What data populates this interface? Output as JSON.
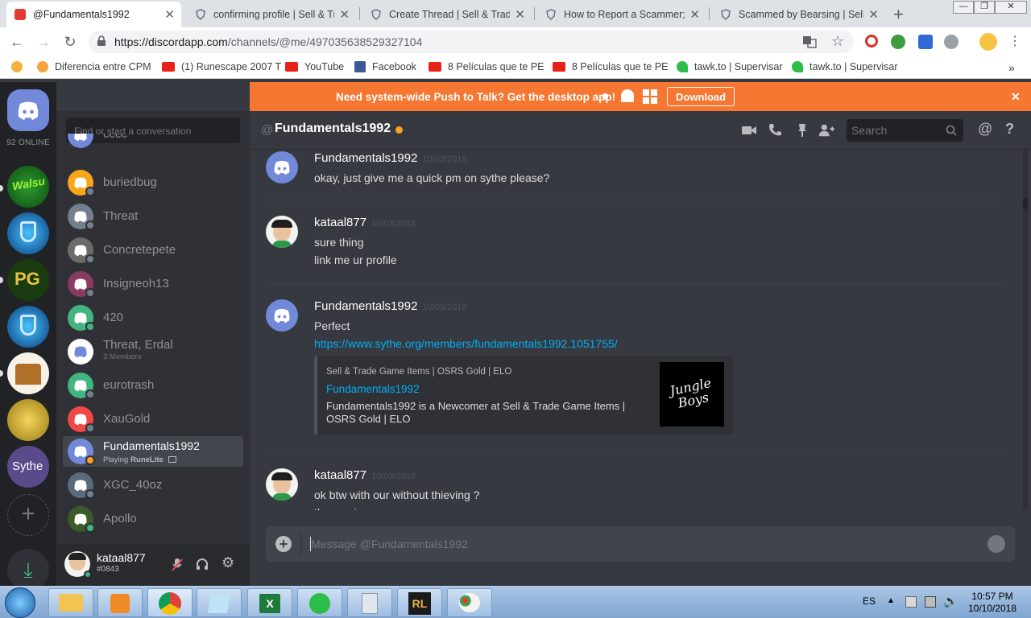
{
  "browser": {
    "tabs": [
      {
        "title": "@Fundamentals1992",
        "active": true,
        "icon": "discord-favicon"
      },
      {
        "title": "confirming profile | Sell & Tra",
        "active": false,
        "icon": "sythe-shield-favicon"
      },
      {
        "title": "Create Thread | Sell & Trade",
        "active": false,
        "icon": "sythe-shield-favicon"
      },
      {
        "title": "How to Report a Scammer; R",
        "active": false,
        "icon": "sythe-shield-favicon"
      },
      {
        "title": "Scammed by Bearsing | Sell",
        "active": false,
        "icon": "sythe-shield-favicon"
      }
    ],
    "url_host": "https://discordapp.com",
    "url_path": "/channels/@me/497035638529327104",
    "bookmarks": [
      {
        "label": "Diferencia entre CPM",
        "icon": "cpm-icon",
        "color": "#5d5f63"
      },
      {
        "label": "(1) Runescape 2007 T",
        "icon": "youtube-icon",
        "color": "#e62117"
      },
      {
        "label": "YouTube",
        "icon": "youtube-icon",
        "color": "#e62117"
      },
      {
        "label": "Facebook",
        "icon": "facebook-icon",
        "color": "#3b5998"
      },
      {
        "label": "8 Películas que te PE",
        "icon": "youtube-icon",
        "color": "#e62117"
      },
      {
        "label": "8 Películas que te PE",
        "icon": "youtube-icon",
        "color": "#e62117"
      },
      {
        "label": "tawk.to | Supervisar",
        "icon": "tawk-icon",
        "color": "#2bbf4a"
      },
      {
        "label": "tawk.to | Supervisar",
        "icon": "tawk-icon",
        "color": "#2bbf4a"
      }
    ]
  },
  "discord": {
    "online_count": "92 ONLINE",
    "banner": {
      "text": "Need system-wide Push to Talk? Get the desktop app!",
      "button": "Download"
    },
    "dm_search_placeholder": "Find or start a conversation",
    "dms": [
      {
        "name": "cccc",
        "status": "#747f8d",
        "avatar_color": "#7289da"
      },
      {
        "name": "buriedbug",
        "status": "#747f8d",
        "avatar_color": "#faa61a"
      },
      {
        "name": "Threat",
        "status": "#747f8d",
        "avatar_color": "#747f8d"
      },
      {
        "name": "Concretepete",
        "status": "#747f8d",
        "avatar_color": "#6b6b6b"
      },
      {
        "name": "Insigneoh13",
        "status": "#747f8d",
        "avatar_color": "#8b3a62"
      },
      {
        "name": "420",
        "status": "#43b581",
        "avatar_color": "#43b581"
      },
      {
        "name": "Threat, Erdal",
        "sub": "3 Members",
        "status": "",
        "avatar_color": "#ffffff"
      },
      {
        "name": "eurotrash",
        "status": "#747f8d",
        "avatar_color": "#43b581"
      },
      {
        "name": "XauGold",
        "status": "#747f8d",
        "avatar_color": "#f04747"
      },
      {
        "name": "Fundamentals1992",
        "sub_prefix": "Playing",
        "sub_game": "RuneLite",
        "status": "#faa61a",
        "avatar_color": "#7289da",
        "selected": true
      },
      {
        "name": "XGC_40oz",
        "status": "#747f8d",
        "avatar_color": "#5a6a7a"
      },
      {
        "name": "Apollo",
        "status": "#43b581",
        "avatar_color": "#3d5a2a"
      }
    ],
    "user": {
      "name": "kataal877",
      "tag": "#0843"
    },
    "chat": {
      "title": "Fundamentals1992",
      "search_placeholder": "Search",
      "composer_placeholder": "Message @Fundamentals1992",
      "messages": [
        {
          "author": "Fundamentals1992",
          "timestamp": "10/03/2018",
          "lines": [
            "okay, just give me a quick pm on sythe please?"
          ],
          "avatar": "discord"
        },
        {
          "author": "kataal877",
          "timestamp": "10/03/2018",
          "lines": [
            "sure thing",
            "link me ur profile"
          ],
          "avatar": "cartoon"
        },
        {
          "author": "Fundamentals1992",
          "timestamp": "10/03/2018",
          "lines": [
            "Perfect"
          ],
          "link": "https://www.sythe.org/members/fundamentals1992.1051755/",
          "avatar": "discord"
        },
        {
          "author": "kataal877",
          "timestamp": "10/03/2018",
          "lines": [
            "ok btw with our without thieving ?",
            "the service"
          ],
          "avatar": "cartoon"
        }
      ],
      "embed": {
        "provider": "Sell & Trade Game Items | OSRS Gold | ELO",
        "title": "Fundamentals1992",
        "description": "Fundamentals1992 is a Newcomer at Sell & Trade Game Items | OSRS Gold | ELO",
        "thumb_text": "Jungle Boys"
      }
    }
  },
  "taskbar": {
    "lang": "ES",
    "time": "10:57 PM",
    "date": "10/10/2018"
  }
}
